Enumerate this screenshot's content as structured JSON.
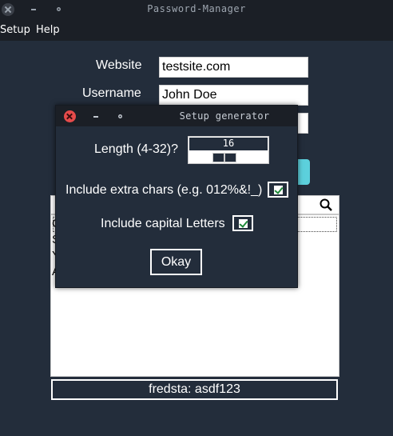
{
  "window": {
    "title": "Password-Manager"
  },
  "menubar": {
    "items": [
      "Setup",
      "Help"
    ]
  },
  "form": {
    "website_label": "Website",
    "website_value": "testsite.com",
    "username_label": "Username",
    "username_value": "John Doe"
  },
  "list": {
    "lines": [
      "C",
      "S",
      "Y",
      "A"
    ]
  },
  "status": {
    "text": "fredsta: asdf123"
  },
  "dialog": {
    "title": "Setup generator",
    "length_label": "Length (4-32)?",
    "length_value": "16",
    "extra_chars_label": "Include extra chars (e.g. 012%&!_)",
    "extra_chars_checked": true,
    "capital_label": "Include capital Letters",
    "capital_checked": true,
    "okay_label": "Okay"
  },
  "colors": {
    "background": "#232d3b",
    "titlebar": "#1b1f26",
    "accent": "#5cd0dc",
    "close_red": "#e64b4b"
  }
}
